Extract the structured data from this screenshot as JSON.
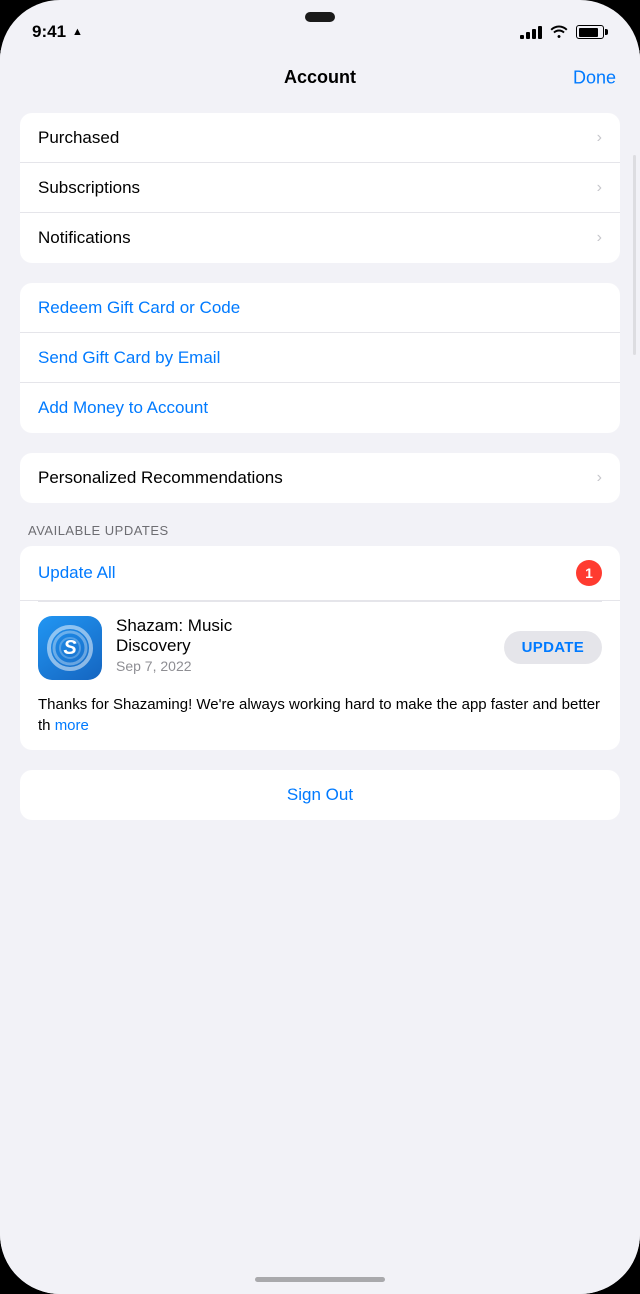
{
  "status_bar": {
    "time": "9:41",
    "location_icon": "▲",
    "signal_strength": 4,
    "wifi": true,
    "battery": 85
  },
  "nav": {
    "title": "Account",
    "done_label": "Done"
  },
  "menu_section_1": {
    "items": [
      {
        "label": "Purchased",
        "has_chevron": true
      },
      {
        "label": "Subscriptions",
        "has_chevron": true
      },
      {
        "label": "Notifications",
        "has_chevron": true
      }
    ]
  },
  "menu_section_2": {
    "items": [
      {
        "label": "Redeem Gift Card or Code",
        "blue": true,
        "has_chevron": false
      },
      {
        "label": "Send Gift Card by Email",
        "blue": true,
        "has_chevron": false
      },
      {
        "label": "Add Money to Account",
        "blue": true,
        "has_chevron": false
      }
    ]
  },
  "menu_section_3": {
    "items": [
      {
        "label": "Personalized Recommendations",
        "has_chevron": true
      }
    ]
  },
  "available_updates": {
    "section_title": "AVAILABLE UPDATES",
    "update_all_label": "Update All",
    "badge_count": "1",
    "app": {
      "name": "Shazam: Music\nDiscovery",
      "date": "Sep 7, 2022",
      "update_btn_label": "UPDATE",
      "description": "Thanks for Shazaming! We're always working hard to make the app faster and better th",
      "more_label": "more"
    }
  },
  "sign_out": {
    "label": "Sign Out"
  }
}
